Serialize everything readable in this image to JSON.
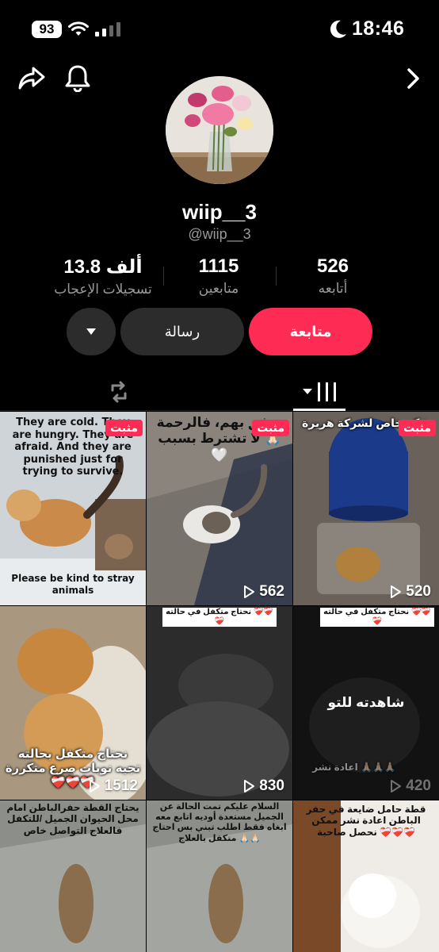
{
  "status_bar": {
    "battery": "93",
    "time": "18:46"
  },
  "profile": {
    "username": "wiip__3",
    "handle": "@wiip__3",
    "stats": [
      {
        "value": "526",
        "label": "أتابعه"
      },
      {
        "value": "1115",
        "label": "متابعين"
      },
      {
        "value": "13.8 ألف",
        "label": "تسجيلات الإعجاب"
      }
    ]
  },
  "actions": {
    "follow": "متابعة",
    "message": "رسالة"
  },
  "icons": {
    "share": "share-icon",
    "bell": "bell-icon",
    "next": "chevron-right-icon",
    "more": "caret-down-icon",
    "repost": "repost-icon",
    "videos": "videos-grid-icon",
    "play": "play-icon"
  },
  "colors": {
    "accent": "#fe2c55",
    "bg": "#000000",
    "muted": "#9a9a9a",
    "chip": "#2c2c2c"
  },
  "videos": [
    {
      "pinned": "مثبت",
      "views": "",
      "caption": "They are cold. They are hungry. They are afraid. And they are punished just for trying to survive.",
      "caption2": "Please be kind to stray animals"
    },
    {
      "pinned": "مثبت",
      "views": "562",
      "caption": "نرفق بهم، فالرحمة لا تشترط بسبب 🙏🏻🤍"
    },
    {
      "pinned": "مثبت",
      "views": "520",
      "caption": "شكر خاص لشركة هريرة"
    },
    {
      "pinned": "",
      "views": "1512",
      "caption": "نحتاج متكفل بحالته تجيه نوبات صرع متكررة ❤️‍🩹❤️‍🩹❤️‍🩹"
    },
    {
      "pinned": "",
      "views": "830",
      "caption": "نحتاج متكفل في حالته ❤️‍🩹❤️‍🩹❤️‍🩹"
    },
    {
      "pinned": "",
      "views": "420",
      "caption": "نحتاج متكفل في حالته ❤️‍🩹❤️‍🩹❤️‍🩹",
      "watched": "شاهدته للتو",
      "caption2": "اعادة نشر 🙏🏻🙏🏻🙏🏻"
    },
    {
      "pinned": "",
      "views": "",
      "caption": "يحتاج القطة حفرالباطن امام محل الحيوان الجميل /للتكفل فالعلاج التواصل خاص"
    },
    {
      "pinned": "",
      "views": "",
      "caption": "السلام عليكم تمت الحالة عن الجميل مستعدة أوديه اتابع معه ابغاه فقط اطلب تبني بس احتاج متكفل بالعلاج 🙏🏻🙏🏻"
    },
    {
      "pinned": "",
      "views": "",
      "caption": "قطة حامل ضايعة في حفر الباطن اعادة نشر ممكن نحصل صاحبة ❤️‍🩹❤️‍🩹❤️‍🩹"
    }
  ]
}
